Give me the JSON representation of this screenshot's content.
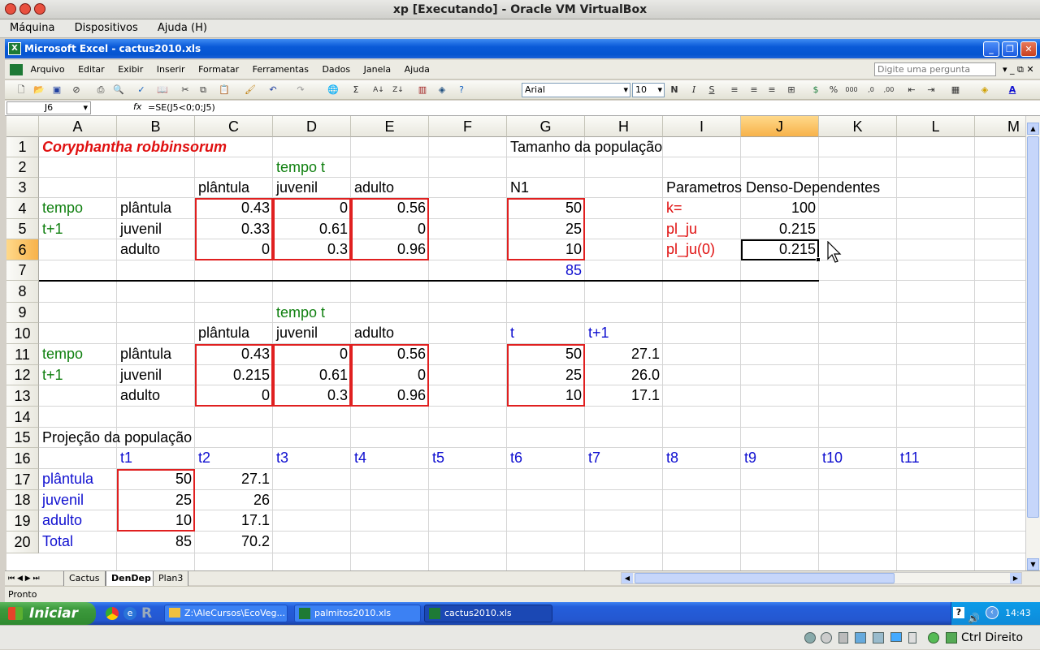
{
  "vbox": {
    "title": "xp [Executando] - Oracle VM VirtualBox",
    "menu": [
      "Máquina",
      "Dispositivos",
      "Ajuda (H)"
    ],
    "status_host_key": "Ctrl Direito"
  },
  "excel": {
    "window_title": "Microsoft Excel - cactus2010.xls",
    "menu": [
      "Arquivo",
      "Editar",
      "Exibir",
      "Inserir",
      "Formatar",
      "Ferramentas",
      "Dados",
      "Janela",
      "Ajuda"
    ],
    "help_placeholder": "Digite uma pergunta",
    "font_name": "Arial",
    "font_size": "10",
    "name_box": "J6",
    "fx": "fx",
    "formula": "=SE(J5<0;0;J5)",
    "columns": [
      "A",
      "B",
      "C",
      "D",
      "E",
      "F",
      "G",
      "H",
      "I",
      "J",
      "K",
      "L",
      "M"
    ],
    "rows": [
      "1",
      "2",
      "3",
      "4",
      "5",
      "6",
      "7",
      "8",
      "9",
      "10",
      "11",
      "12",
      "13",
      "14",
      "15",
      "16",
      "17",
      "18",
      "19",
      "20"
    ],
    "cells": {
      "A1": "Coryphantha robbinsorum",
      "G1": "Tamanho da população",
      "D2": "tempo t",
      "C3": "plântula",
      "D3": "juvenil",
      "E3": "adulto",
      "G3": "N1",
      "I3": "Parametros Denso-Dependentes",
      "A4": "tempo",
      "B4": "plântula",
      "C4": "0.43",
      "D4": "0",
      "E4": "0.56",
      "G4": "50",
      "I4": "k=",
      "J4": "100",
      "A5": "t+1",
      "B5": "juvenil",
      "C5": "0.33",
      "D5": "0.61",
      "E5": "0",
      "G5": "25",
      "I5": "pl_ju",
      "J5": "0.215",
      "B6": "adulto",
      "C6": "0",
      "D6": "0.3",
      "E6": "0.96",
      "G6": "10",
      "I6": "pl_ju(0)",
      "J6": "0.215",
      "G7": "85",
      "D9": "tempo t",
      "C10": "plântula",
      "D10": "juvenil",
      "E10": "adulto",
      "G10": "t",
      "H10": "t+1",
      "A11": "tempo",
      "B11": "plântula",
      "C11": "0.43",
      "D11": "0",
      "E11": "0.56",
      "G11": "50",
      "H11": "27.1",
      "A12": "t+1",
      "B12": "juvenil",
      "C12": "0.215",
      "D12": "0.61",
      "E12": "0",
      "G12": "25",
      "H12": "26.0",
      "B13": "adulto",
      "C13": "0",
      "D13": "0.3",
      "E13": "0.96",
      "G13": "10",
      "H13": "17.1",
      "A15": "Projeção da população",
      "B16": "t1",
      "C16": "t2",
      "D16": "t3",
      "E16": "t4",
      "F16": "t5",
      "G16": "t6",
      "H16": "t7",
      "I16": "t8",
      "J16": "t9",
      "K16": "t10",
      "L16": "t11",
      "A17": "plântula",
      "B17": "50",
      "C17": "27.1",
      "A18": "juvenil",
      "B18": "25",
      "C18": "26",
      "A19": "adulto",
      "B19": "10",
      "C19": "17.1",
      "A20": "Total",
      "B20": "85",
      "C20": "70.2"
    },
    "sheet_tabs": [
      "Cactus",
      "DenDep",
      "Plan3"
    ],
    "active_tab": "DenDep",
    "status": "Pronto"
  },
  "taskbar": {
    "start": "Iniciar",
    "tasks": [
      "Z:\\AleCursos\\EcoVeg...",
      "palmitos2010.xls",
      "cactus2010.xls"
    ],
    "clock": "14:43"
  }
}
